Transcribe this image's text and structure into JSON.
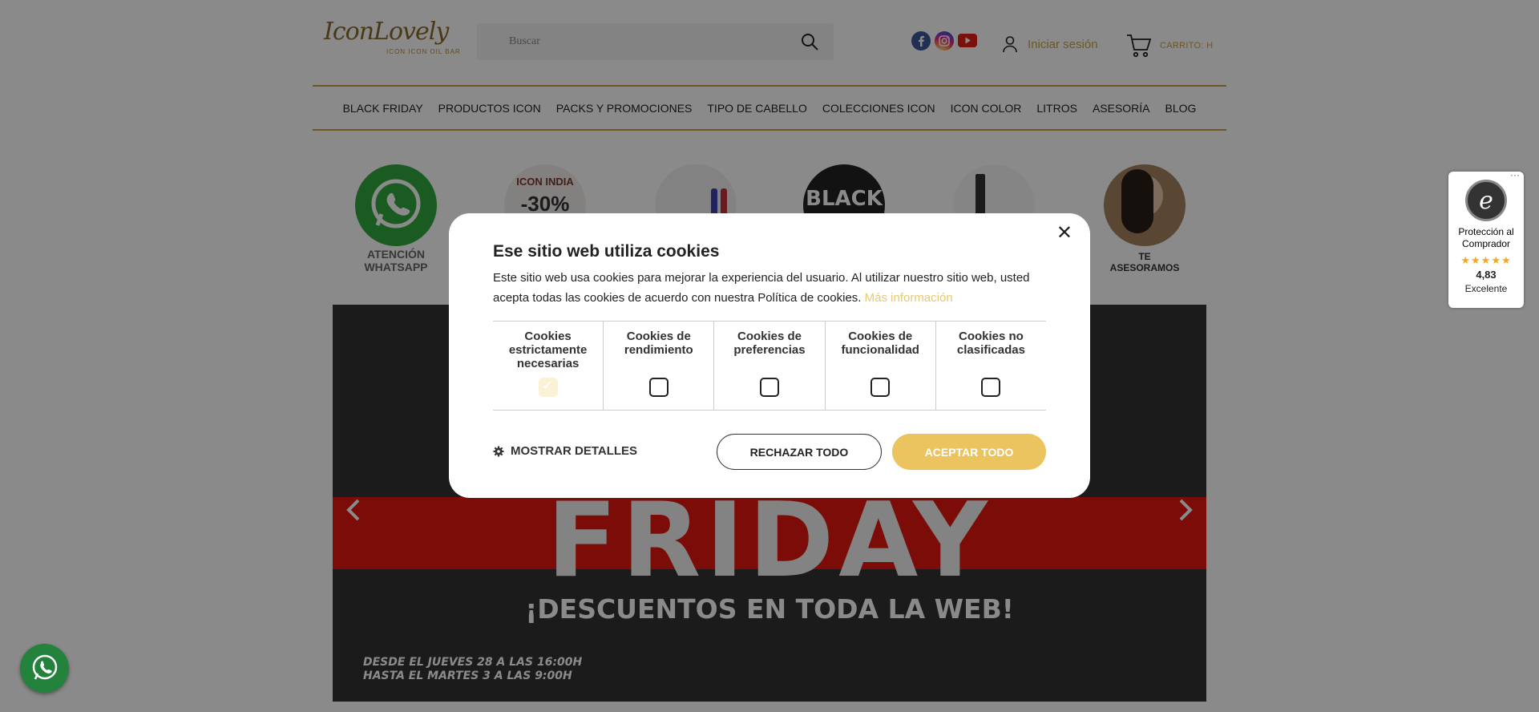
{
  "header": {
    "logo_text": "IconLovely",
    "logo_subtext": "ICON ICON OIL BAR",
    "search": {
      "placeholder": "Buscar"
    },
    "login_label": "Iniciar sesión",
    "cart_label": "CARRITO: H"
  },
  "nav": {
    "items": [
      {
        "label": "BLACK FRIDAY"
      },
      {
        "label": "PRODUCTOS ICON"
      },
      {
        "label": "PACKS Y PROMOCIONES"
      },
      {
        "label": "TIPO DE CABELLO"
      },
      {
        "label": "COLECCIONES ICON"
      },
      {
        "label": "ICON COLOR"
      },
      {
        "label": "LITROS"
      },
      {
        "label": "ASESORÍA"
      },
      {
        "label": "BLOG"
      }
    ]
  },
  "circles": {
    "whatsapp_caption_1": "ATENCIÓN",
    "whatsapp_caption_2": "WHATSAPP",
    "india_title": "ICON INDIA",
    "india_discount": "-30%",
    "black_text": "BLACK",
    "advice_caption_1": "TE",
    "advice_caption_2": "ASESORAMOS"
  },
  "banner": {
    "headline": "FRIDAY",
    "subheadline": "¡DESCUENTOS EN TODA LA WEB!",
    "date_line_1": "DESDE EL JUEVES 28 A LAS 16:00H",
    "date_line_2": "HASTA EL MARTES 3 A LAS 9:00H"
  },
  "trusted_shops": {
    "seal_letter": "e",
    "protection_line_1": "Protección al",
    "protection_line_2": "Comprador",
    "stars": "★★★★★",
    "score": "4,83",
    "rating_label": "Excelente",
    "menu": "···"
  },
  "cookie_modal": {
    "close": "✕",
    "title": "Ese sitio web utiliza cookies",
    "description": "Este sitio web usa cookies para mejorar la experiencia del usuario. Al utilizar nuestro sitio web, usted acepta todas las cookies de acuerdo con nuestra Política de cookies.",
    "more_info": "Más información",
    "categories": [
      {
        "label": "Cookies estrictamente necesarias",
        "checked": true,
        "disabled": true
      },
      {
        "label": "Cookies de rendimiento",
        "checked": false
      },
      {
        "label": "Cookies de preferencias",
        "checked": false
      },
      {
        "label": "Cookies de funcionalidad",
        "checked": false
      },
      {
        "label": "Cookies no clasificadas",
        "checked": false
      }
    ],
    "show_details": "MOSTRAR DETALLES",
    "reject_all": "RECHAZAR TODO",
    "accept_all": "ACEPTAR TODO"
  },
  "colors": {
    "accent_gold": "#c9a344",
    "accept_button": "#ebc35f",
    "banner_red": "#e4170e",
    "whatsapp_green": "#23823c"
  }
}
